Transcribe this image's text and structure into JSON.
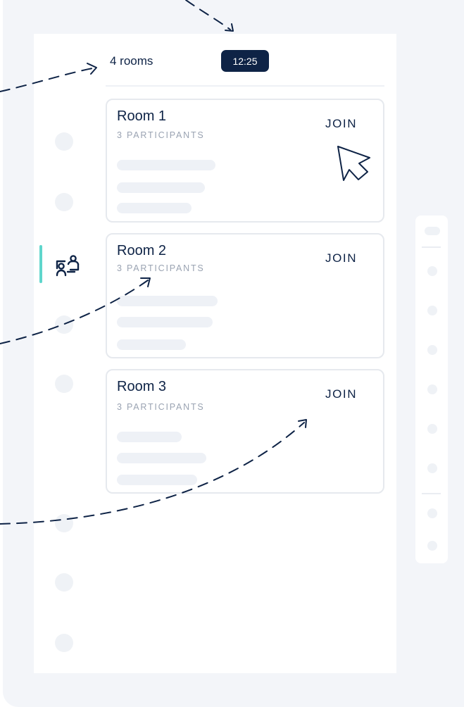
{
  "header": {
    "room_count": "4 rooms",
    "time": "12:25"
  },
  "rooms": [
    {
      "title": "Room 1",
      "participants": "3 PARTICIPANTS",
      "join_label": "JOIN"
    },
    {
      "title": "Room 2",
      "participants": "3 PARTICIPANTS",
      "join_label": "JOIN"
    },
    {
      "title": "Room 3",
      "participants": "3 PARTICIPANTS",
      "join_label": "JOIN"
    }
  ],
  "sidebar": {
    "active_item": "rooms-icon",
    "accent_color": "#5fd6cc"
  },
  "colors": {
    "brand_navy": "#0e2346",
    "background": "#f3f5f9",
    "skeleton": "#eef1f6"
  },
  "icons": [
    "rooms-icon",
    "pointer-cursor-icon",
    "dashed-arrow"
  ]
}
